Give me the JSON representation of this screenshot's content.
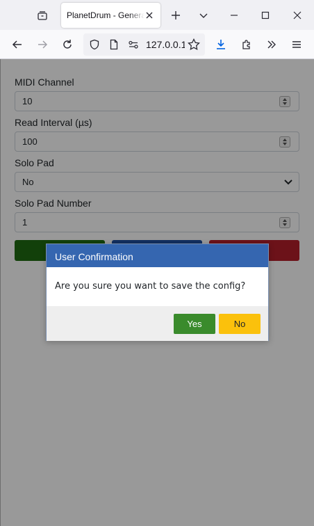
{
  "browser": {
    "tab_title": "PlanetDrum - General",
    "url": "127.0.0.1",
    "icons": [
      "tab-list-icon",
      "close-tab-icon",
      "new-tab-icon",
      "list-all-tabs-icon",
      "minimize-icon",
      "maximize-icon",
      "close-window-icon",
      "back-icon",
      "forward-icon",
      "reload-icon",
      "shield-icon",
      "page-icon",
      "permissions-icon",
      "bookmark-star-icon",
      "download-icon",
      "extensions-icon",
      "overflow-icon",
      "menu-icon"
    ]
  },
  "form": {
    "midi_channel": {
      "label": "MIDI Channel",
      "value": "10"
    },
    "read_interval": {
      "label": "Read Interval (µs)",
      "value": "100"
    },
    "solo_pad": {
      "label": "Solo Pad",
      "value": "No"
    },
    "solo_pad_number": {
      "label": "Solo Pad Number",
      "value": "1"
    }
  },
  "action_button_colors": [
    "#1f6b12",
    "#1e4fa0",
    "#b51e2a"
  ],
  "modal": {
    "title": "User Confirmation",
    "message": "Are you sure you want to save the config?",
    "yes_label": "Yes",
    "no_label": "No",
    "colors": {
      "header": "#3566b0",
      "yes": "#3a8b2c",
      "no": "#fbc10c"
    }
  }
}
